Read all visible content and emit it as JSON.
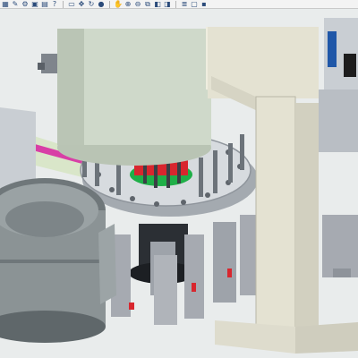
{
  "app": {
    "view": "3D assembly viewport"
  },
  "toolbar": {
    "items": [
      {
        "name": "grid-icon",
        "glyph": "▦"
      },
      {
        "name": "pen-icon",
        "glyph": "✎"
      },
      {
        "name": "settings-icon",
        "glyph": "⚙"
      },
      {
        "name": "folder-icon",
        "glyph": "▣"
      },
      {
        "name": "print-icon",
        "glyph": "▤"
      },
      {
        "name": "help-icon",
        "glyph": "?"
      },
      {
        "name": "select-icon",
        "glyph": "▭"
      },
      {
        "name": "pan-icon",
        "glyph": "✥"
      },
      {
        "name": "rotate-icon",
        "glyph": "↻"
      },
      {
        "name": "render-icon",
        "glyph": "●"
      },
      {
        "name": "hand-icon",
        "glyph": "✋"
      },
      {
        "name": "zoom-in-icon",
        "glyph": "⊕"
      },
      {
        "name": "zoom-out-icon",
        "glyph": "⊖"
      },
      {
        "name": "zoom-fit-icon",
        "glyph": "⧉"
      },
      {
        "name": "view-front-icon",
        "glyph": "◧"
      },
      {
        "name": "view-side-icon",
        "glyph": "◨"
      },
      {
        "name": "layers-icon",
        "glyph": "≣"
      },
      {
        "name": "display-icon",
        "glyph": "▢"
      },
      {
        "name": "save-icon",
        "glyph": "▪"
      }
    ]
  },
  "colors": {
    "background": "#e9ecec",
    "rotary_body": "#c9d4c4",
    "pillar": "#e4e2d2",
    "bowl": "#8b9395",
    "grey_parts": "#a6aab1",
    "red_part": "#d8262e",
    "green_part": "#1faf48",
    "magenta_rail": "#d83fa6",
    "blue_cabinet": "#1f57a8"
  }
}
